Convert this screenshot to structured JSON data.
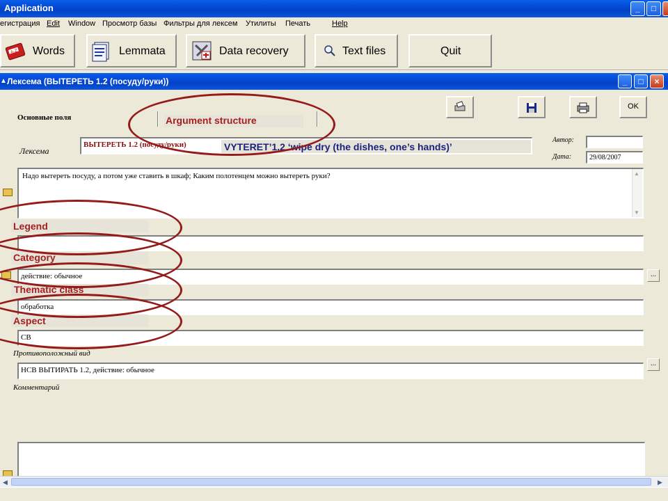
{
  "app": {
    "title": "Application",
    "win_min": "_",
    "win_max": "□",
    "win_close": "×"
  },
  "menu": [
    "егистрация",
    "Edit",
    "Window",
    "Просмотр базы",
    "Фильтры для лексем",
    "Утилиты",
    "Печать",
    "Help"
  ],
  "toolbar": {
    "words": "Words",
    "lemmata": "Lemmata",
    "data_recovery": "Data recovery",
    "text_files": "Text files",
    "quit": "Quit"
  },
  "child_window": {
    "title": "Лексема  (ВЫТЕРЕТЬ 1.2 (посуду/руки))",
    "ok_label": "OK"
  },
  "tabs": {
    "main": "Основные поля",
    "argument_structure": "Argument structure"
  },
  "form": {
    "lexeme_label": "Лексема",
    "lexeme_value": "ВЫТЕРЕТЬ 1.2 (посуду/руки)",
    "lexeme_gloss": "VYTERET’1.2 ‘wipe dry (the dishes, one’s hands)’",
    "author_label": "Автор:",
    "author_value": "",
    "date_label": "Дата:",
    "date_value": "29/08/2007",
    "examples_value": "Надо вытереть посуду, а потом уже ставить в шкаф; Каким полотенцем можно вытереть руки?",
    "legend_label": "Legend",
    "legend_value": "",
    "category_label": "Category",
    "category_value": "действие: обычное",
    "thematic_label": "Thematic class",
    "thematic_value": "обработка",
    "aspect_label": "Aspect",
    "aspect_value": "СВ",
    "opposite_label": "Противоположный вид",
    "opposite_value": "НСВ ВЫТИРАТЬ 1.2, действие: обычное",
    "comment_label": "Комментарий",
    "comment_value": "",
    "dots": "..."
  },
  "colors": {
    "annotation": "#951b1b",
    "titlebar": "#0449d6",
    "window_bg": "#ece9d8"
  }
}
